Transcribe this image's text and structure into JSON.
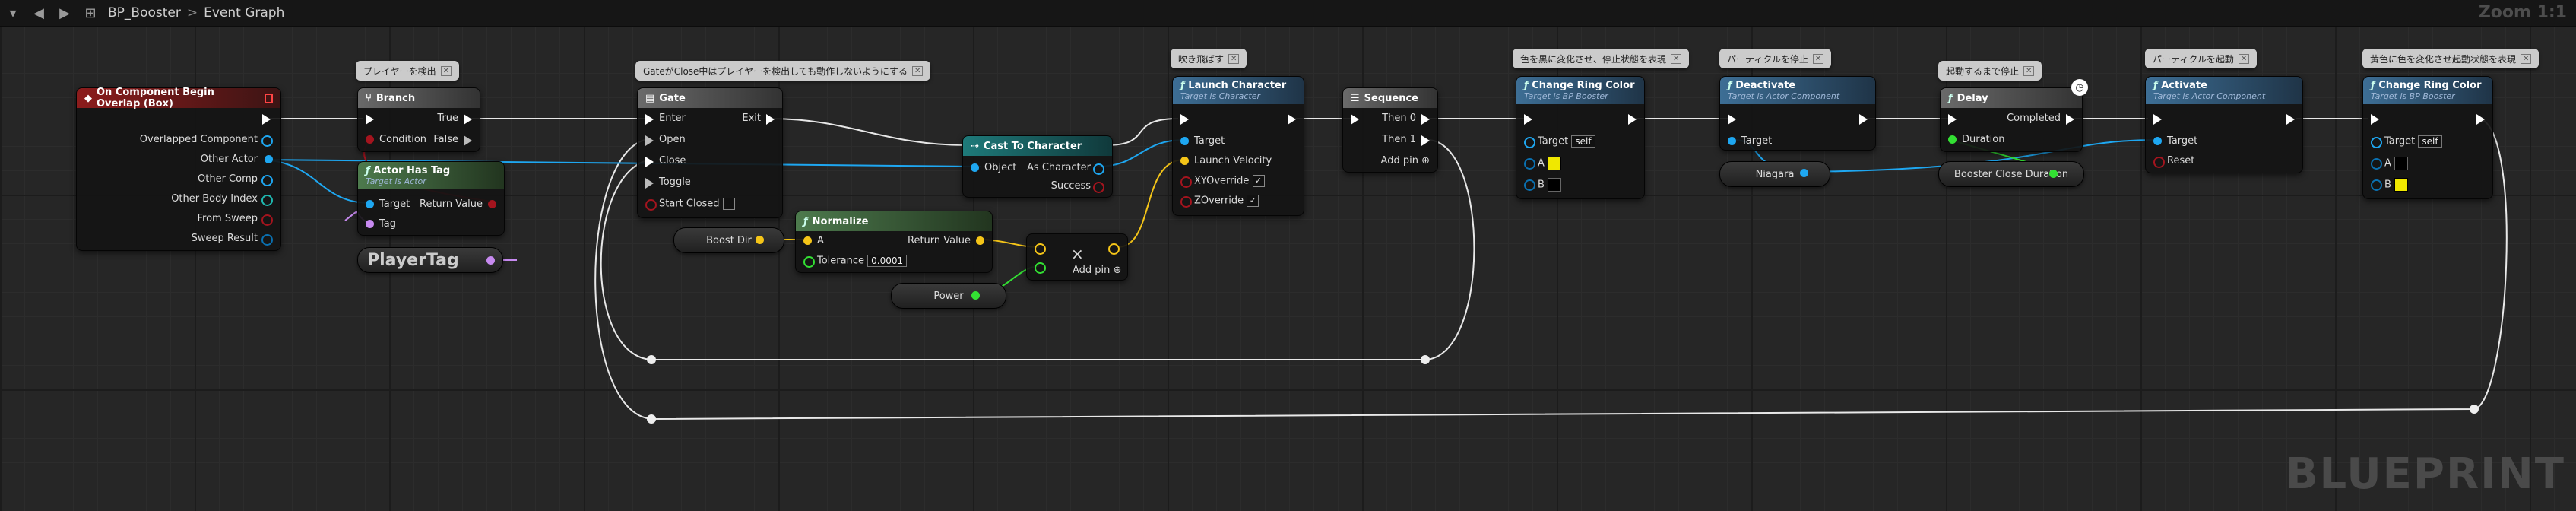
{
  "toolbar": {
    "menu_icon": "blueprint-menu-icon",
    "back_icon": "back-arrow-icon",
    "forward_icon": "forward-arrow-icon",
    "hierarchy_icon": "hierarchy-icon",
    "asset": "BP_Booster",
    "separator": ">",
    "graph": "Event Graph",
    "zoom": "Zoom 1:1"
  },
  "watermark": "BLUEPRINT",
  "comments": {
    "branch": "プレイヤーを検出",
    "gate": "GateがClose中はプレイヤーを検出しても動作しないようにする",
    "launch": "吹き飛ばす",
    "change1": "色を黒に変化させ、停止状態を表現",
    "deactivate": "パーティクルを停止",
    "delay": "起動するまで停止",
    "activate": "パーティクルを起動",
    "change2": "黄色に色を変化させ起動状態を表現"
  },
  "nodes": {
    "overlap": {
      "title": "On Component Begin Overlap (Box)",
      "pins": [
        "Overlapped Component",
        "Other Actor",
        "Other Comp",
        "Other Body Index",
        "From Sweep",
        "Sweep Result"
      ]
    },
    "branch": {
      "title": "Branch",
      "condition": "Condition",
      "true": "True",
      "false": "False"
    },
    "actor_has_tag": {
      "title": "Actor Has Tag",
      "subtitle": "Target is Actor",
      "target": "Target",
      "tag": "Tag",
      "return": "Return Value"
    },
    "gate": {
      "title": "Gate",
      "enter": "Enter",
      "open": "Open",
      "close": "Close",
      "toggle": "Toggle",
      "start_closed": "Start Closed",
      "exit": "Exit"
    },
    "cast": {
      "title": "Cast To Character",
      "object": "Object",
      "as_character": "As Character",
      "success": "Success"
    },
    "normalize": {
      "title": "Normalize",
      "a": "A",
      "tolerance": "Tolerance",
      "tolerance_value": "0.0001",
      "return": "Return Value"
    },
    "multiply": {
      "symbol": "×",
      "add_pin": "Add pin"
    },
    "launch": {
      "title": "Launch Character",
      "subtitle": "Target is Character",
      "target": "Target",
      "velocity": "Launch Velocity",
      "xy": "XYOverride",
      "z": "ZOverride"
    },
    "sequence": {
      "title": "Sequence",
      "then0": "Then 0",
      "then1": "Then 1",
      "add_pin": "Add pin"
    },
    "change1": {
      "title": "Change Ring Color",
      "subtitle": "Target is BP Booster",
      "target": "Target",
      "self": "self",
      "a": "A",
      "b": "B",
      "a_color": "#f0e800",
      "b_color": "#000000"
    },
    "deactivate": {
      "title": "Deactivate",
      "subtitle": "Target is Actor Component",
      "target": "Target"
    },
    "delay": {
      "title": "Delay",
      "duration": "Duration",
      "completed": "Completed"
    },
    "activate": {
      "title": "Activate",
      "subtitle": "Target is Actor Component",
      "target": "Target",
      "reset": "Reset"
    },
    "change2": {
      "title": "Change Ring Color",
      "subtitle": "Target is BP Booster",
      "target": "Target",
      "self": "self",
      "a": "A",
      "b": "B",
      "a_color": "#000000",
      "b_color": "#f0e800"
    }
  },
  "variables": {
    "player_tag": "PlayerTag",
    "boost_dir": "Boost Dir",
    "power": "Power",
    "niagara": "Niagara",
    "booster_close_duration": "Booster Close Duration"
  },
  "pin_colors": {
    "object": "#1ea7f1",
    "vector": "#f5c518",
    "bool": "#a4141e",
    "float": "#33e033",
    "name": "#c78af0",
    "struct": "#0a70b0",
    "exec": "#ffffff"
  }
}
